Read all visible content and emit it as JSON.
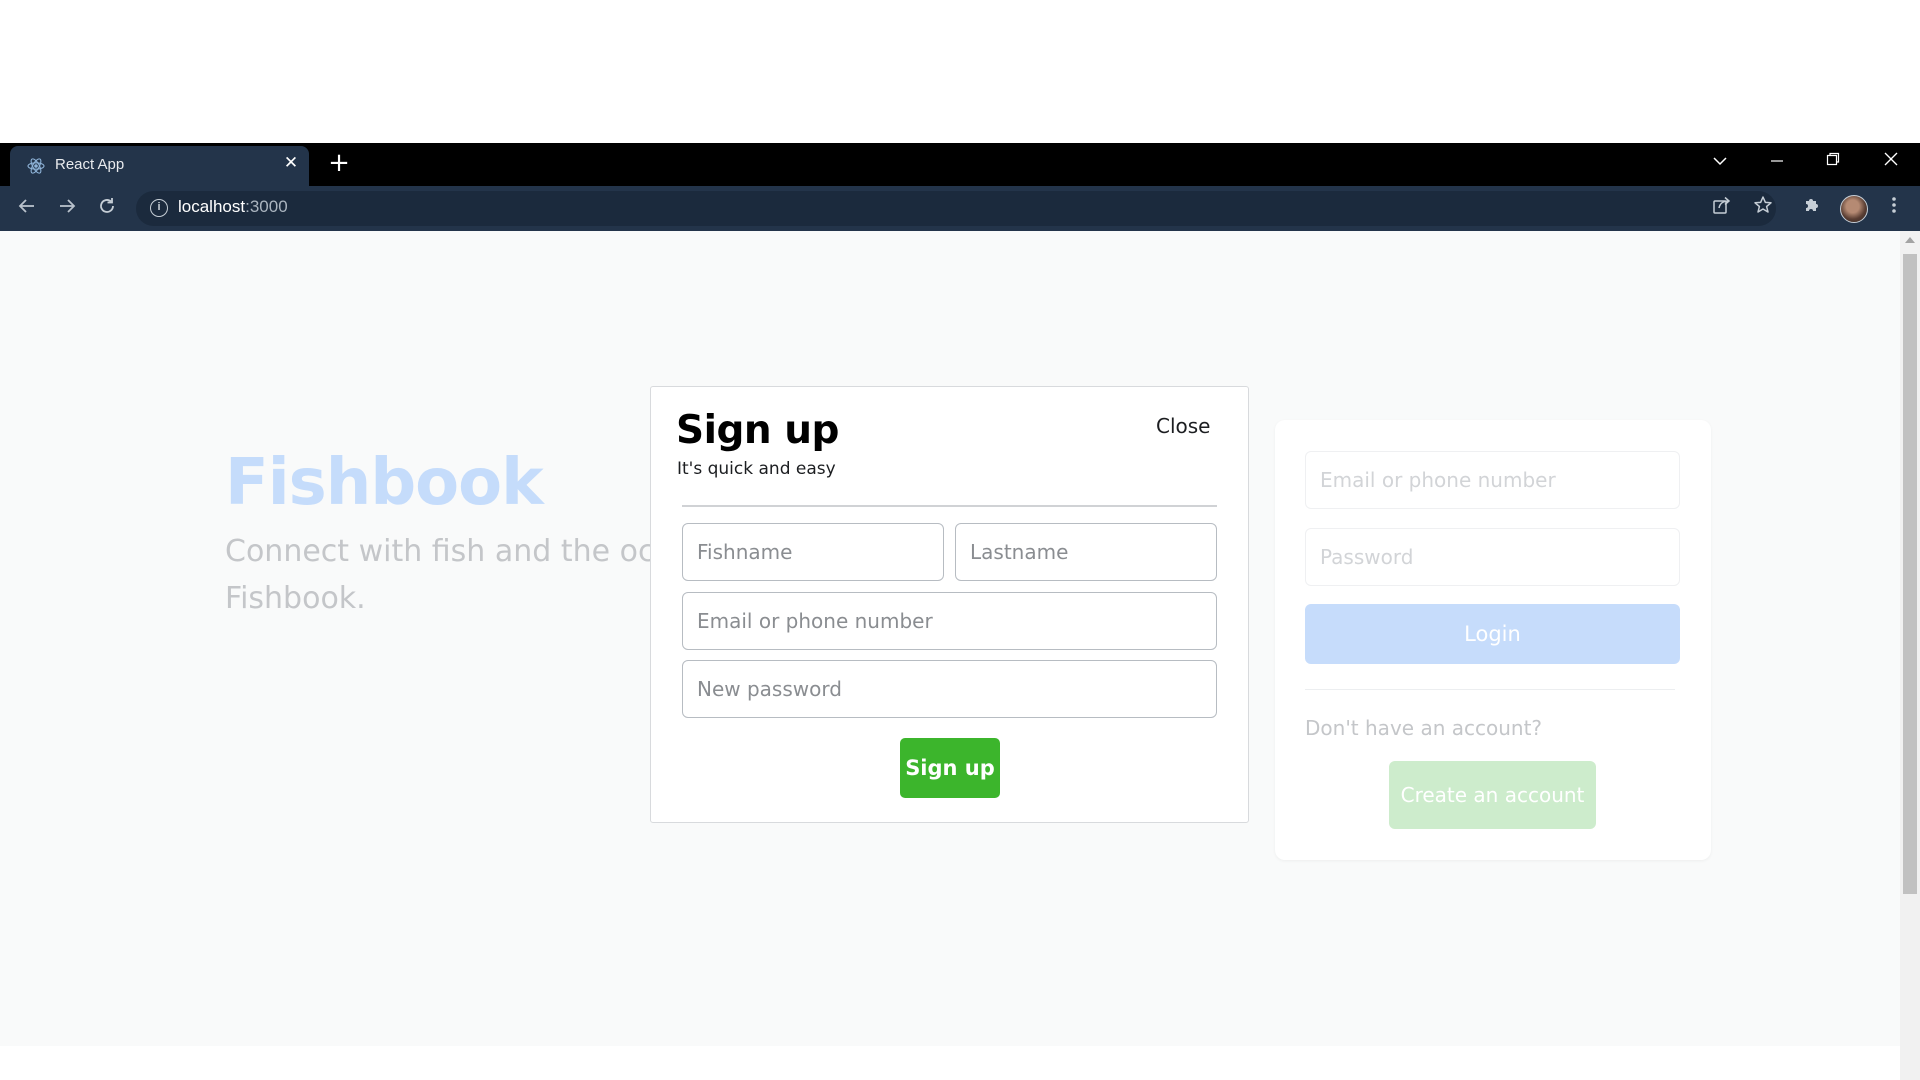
{
  "browser": {
    "tab_title": "React App",
    "tab_favicon": "react-logo-icon",
    "url_host": "localhost",
    "url_port": ":3000",
    "icons": {
      "back": "arrow-left-icon",
      "forward": "arrow-right-icon",
      "reload": "reload-icon",
      "info": "info-icon",
      "share": "share-icon",
      "bookmark": "star-icon",
      "extensions": "puzzle-icon",
      "menu": "kebab-menu-icon"
    }
  },
  "page": {
    "brand": "Fishbook",
    "tagline_line1": "Connect with fish and the ocean around you on",
    "tagline_line2": "Fishbook."
  },
  "login": {
    "email_placeholder": "Email or phone number",
    "password_placeholder": "Password",
    "login_label": "Login",
    "no_account_text": "Don't have an account?",
    "create_label": "Create an account"
  },
  "signup_modal": {
    "title": "Sign up",
    "subtitle": "It's quick and easy",
    "close_label": "Close",
    "firstname_placeholder": "Fishname",
    "lastname_placeholder": "Lastname",
    "email_placeholder": "Email or phone number",
    "password_placeholder": "New password",
    "submit_label": "Sign up"
  },
  "colors": {
    "brand_blue": "#c5dcfb",
    "signup_green": "#3cb52c",
    "chrome_toolbar": "#23344a"
  }
}
